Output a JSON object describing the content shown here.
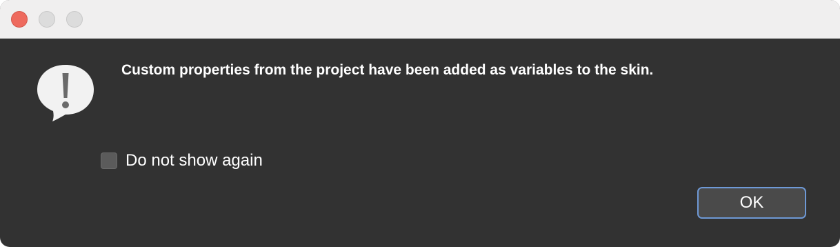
{
  "window": {
    "controls": [
      "close",
      "minimize",
      "maximize"
    ]
  },
  "dialog": {
    "icon": "alert-speech-bubble-icon",
    "message": "Custom properties from the project have been added as variables to the skin.",
    "checkbox": {
      "label": "Do not show again",
      "checked": false
    },
    "ok_button_label": "OK"
  },
  "colors": {
    "close_button": "#ee6a5e",
    "background": "#323232",
    "titlebar": "#f0efef",
    "focus_ring": "#6e99d6"
  }
}
